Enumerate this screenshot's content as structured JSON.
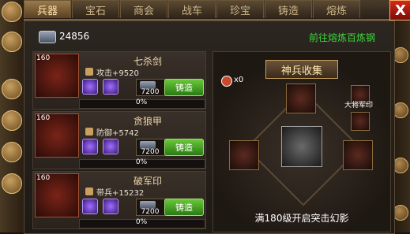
{
  "tabs": [
    "兵器",
    "宝石",
    "商会",
    "战车",
    "珍宝",
    "铸造",
    "熔炼"
  ],
  "close_label": "X",
  "currency": {
    "iron_icon": "iron-ingot-icon",
    "amount": "24856"
  },
  "goto_label": "前往熔炼百炼钢",
  "items": [
    {
      "level": "160",
      "name": "七杀剑",
      "stat": "攻击+9520",
      "stat_icon": "sword-icon",
      "cost": "7200",
      "forge_label": "铸造",
      "progress": "0%"
    },
    {
      "level": "160",
      "name": "贪狼甲",
      "stat": "防御+5742",
      "stat_icon": "shield-icon",
      "cost": "7200",
      "forge_label": "铸造",
      "progress": "0%"
    },
    {
      "level": "160",
      "name": "破军印",
      "stat": "带兵+15232",
      "stat_icon": "seal-icon",
      "cost": "7200",
      "forge_label": "铸造",
      "progress": "0%"
    }
  ],
  "collection": {
    "title": "神兵收集",
    "hammer_count": "x0",
    "seal_label": "大将军印",
    "unlock_text": "满180级开启突击幻影"
  }
}
